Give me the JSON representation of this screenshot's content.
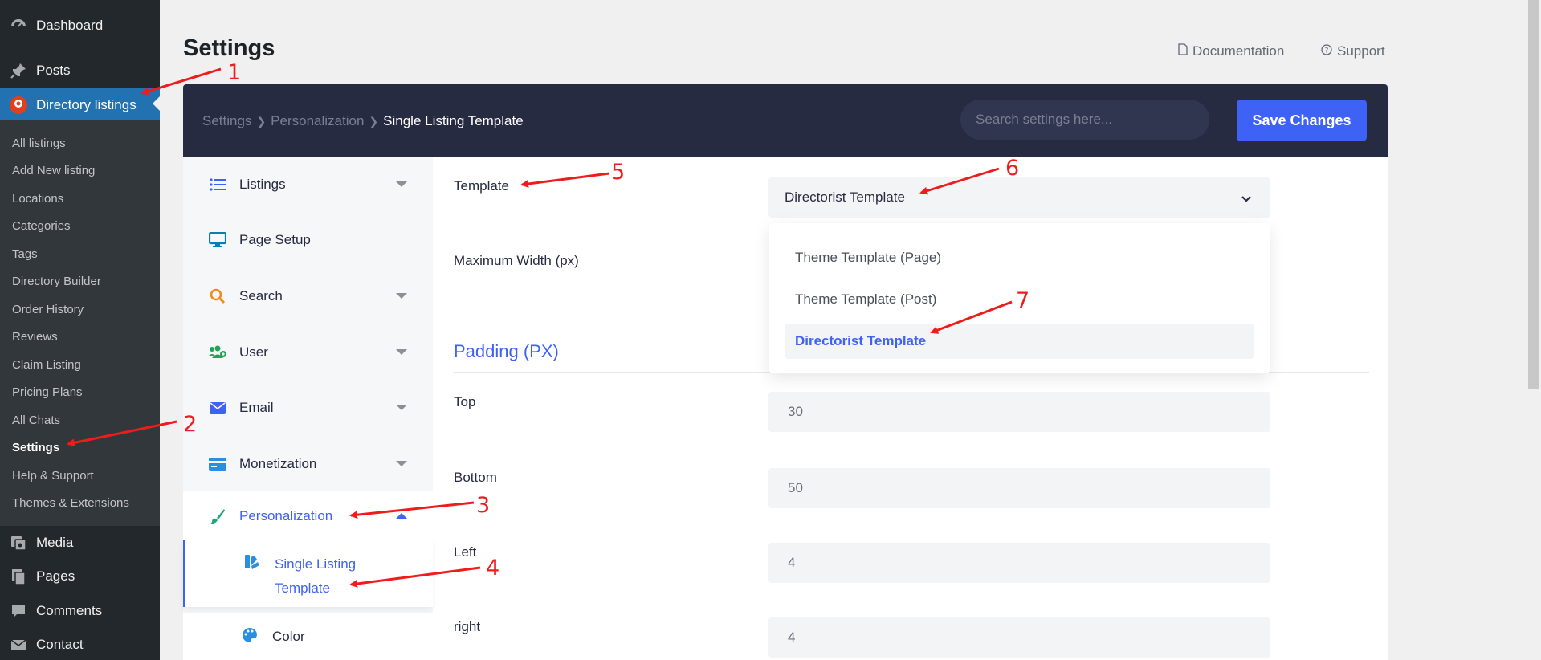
{
  "admin_menu": {
    "dashboard": "Dashboard",
    "posts": "Posts",
    "directory": "Directory listings",
    "sub_items": [
      "All listings",
      "Add New listing",
      "Locations",
      "Categories",
      "Tags",
      "Directory Builder",
      "Order History",
      "Reviews",
      "Claim Listing",
      "Pricing Plans",
      "All Chats",
      "Settings",
      "Help & Support",
      "Themes & Extensions"
    ],
    "media": "Media",
    "pages": "Pages",
    "comments": "Comments",
    "contact": "Contact"
  },
  "header": {
    "title": "Settings",
    "documentation": "Documentation",
    "support": "Support"
  },
  "topbar": {
    "breadcrumb": [
      "Settings",
      "Personalization",
      "Single Listing Template"
    ],
    "search_placeholder": "Search settings here...",
    "save_label": "Save Changes"
  },
  "nav": {
    "items": [
      {
        "label": "Listings",
        "icon": "list-icon"
      },
      {
        "label": "Page Setup",
        "icon": "monitor-icon"
      },
      {
        "label": "Search",
        "icon": "search-icon"
      },
      {
        "label": "User",
        "icon": "users-gear-icon"
      },
      {
        "label": "Email",
        "icon": "envelope-icon"
      },
      {
        "label": "Monetization",
        "icon": "credit-card-icon"
      },
      {
        "label": "Personalization",
        "icon": "paintbrush-icon"
      }
    ],
    "sub_single": "Single Listing Template",
    "sub_color": "Color"
  },
  "content": {
    "template_label": "Template",
    "template_value": "Directorist Template",
    "options": [
      "Theme Template (Page)",
      "Theme Template (Post)",
      "Directorist Template"
    ],
    "max_width_label": "Maximum Width (px)",
    "padding_title": "Padding (PX)",
    "fields": [
      {
        "label": "Top",
        "value": "30"
      },
      {
        "label": "Bottom",
        "value": "50"
      },
      {
        "label": "Left",
        "value": "4"
      },
      {
        "label": "right",
        "value": "4"
      }
    ]
  },
  "annotations": [
    "1",
    "2",
    "3",
    "4",
    "5",
    "6",
    "7"
  ],
  "colors": {
    "accent": "#3e62f5",
    "wp_sidebar": "#23282d",
    "wp_active": "#2271b1",
    "topbar": "#272b41",
    "annotation": "#ee1c1c"
  }
}
